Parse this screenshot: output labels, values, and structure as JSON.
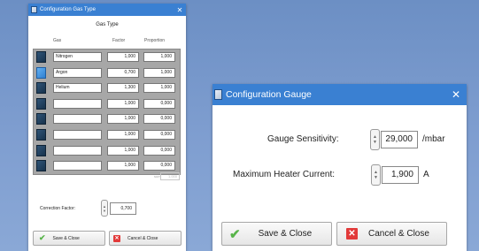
{
  "gas_window": {
    "title": "Configuration Gas Type",
    "close_label": "✕",
    "heading": "Gas Type",
    "columns": {
      "gas": "Gas",
      "factor": "Factor",
      "proportion": "Proportion"
    },
    "rows": [
      {
        "name": "Nitrogen",
        "factor": "1,000",
        "proportion": "1,000",
        "selected": false
      },
      {
        "name": "Argon",
        "factor": "0,700",
        "proportion": "1,000",
        "selected": true
      },
      {
        "name": "Helium",
        "factor": "1,300",
        "proportion": "1,000",
        "selected": false
      },
      {
        "name": "",
        "factor": "1,000",
        "proportion": "0,000",
        "selected": false
      },
      {
        "name": "",
        "factor": "1,000",
        "proportion": "0,000",
        "selected": false
      },
      {
        "name": "",
        "factor": "1,000",
        "proportion": "0,000",
        "selected": false
      },
      {
        "name": "",
        "factor": "1,000",
        "proportion": "0,000",
        "selected": false
      },
      {
        "name": "",
        "factor": "1,000",
        "proportion": "0,000",
        "selected": false
      }
    ],
    "sum_label": "sum",
    "sum_value": "1,000",
    "correction_factor_label": "Correction Factor:",
    "correction_factor_value": "0,700",
    "save_label": "Save & Close",
    "cancel_label": "Cancel & Close"
  },
  "gauge_window": {
    "title": "Configuration Gauge",
    "close_label": "✕",
    "sensitivity_label": "Gauge Sensitivity:",
    "sensitivity_value": "29,000",
    "sensitivity_unit": "/mbar",
    "heater_label": "Maximum Heater Current:",
    "heater_value": "1,900",
    "heater_unit": "A",
    "save_label": "Save & Close",
    "cancel_label": "Cancel & Close"
  },
  "colors": {
    "background": "#7a9bcf",
    "titlebar": "#3a80d2",
    "selected_icon": "#3f94e4",
    "icon": "#1f3e5c",
    "save_check": "#58b44a",
    "cancel_x": "#e23a3a"
  },
  "icons": {
    "window": "app-window-icon",
    "close": "close-icon",
    "save": "check-icon",
    "cancel": "x-box-icon"
  }
}
